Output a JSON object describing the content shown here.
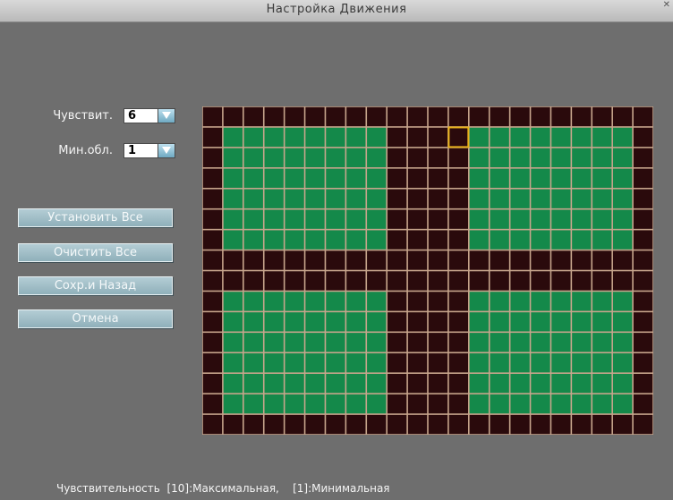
{
  "window": {
    "title": "Настройка Движения"
  },
  "settings": {
    "sensitivity_label": "Чувствит.",
    "sensitivity_value": "6",
    "min_area_label": "Мин.обл.",
    "min_area_value": "1"
  },
  "buttons": {
    "set_all": "Установить Все",
    "clear_all": "Очистить Все",
    "save_back": "Сохр.и Назад",
    "cancel": "Отмена"
  },
  "motion_grid": {
    "columns": 22,
    "rows": 16,
    "active_color": "#14894a",
    "inactive_color": "#2a0a0c",
    "line_color": "#c7a58c",
    "cursor_color": "#e8b21c",
    "cursor_cell": {
      "col": 12,
      "row": 1
    },
    "active_rows": [
      1,
      2,
      3,
      4,
      5,
      6,
      9,
      10,
      11,
      12,
      13,
      14
    ],
    "active_cols": [
      1,
      2,
      3,
      4,
      5,
      6,
      7,
      8,
      13,
      14,
      15,
      16,
      17,
      18,
      19,
      20
    ]
  },
  "footer": {
    "text": "Чувствительность  [10]:Максимальная,    [1]:Минимальная"
  }
}
